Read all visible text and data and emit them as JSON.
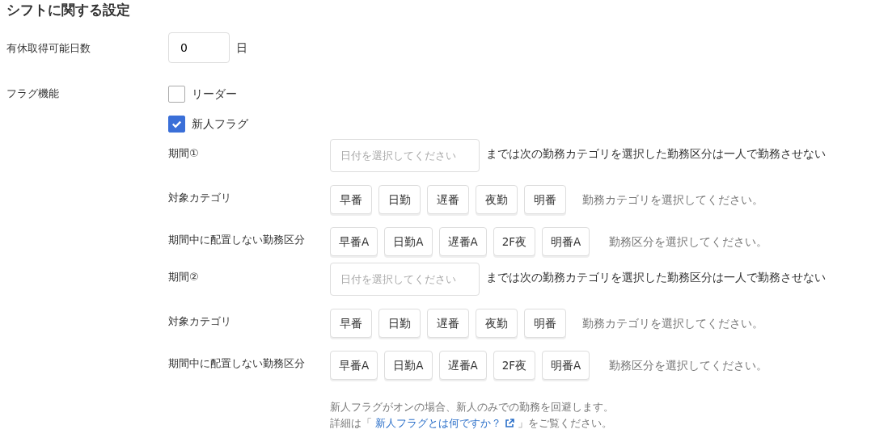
{
  "title": "シフトに関する設定",
  "paid_leave": {
    "label": "有休取得可能日数",
    "value": "0",
    "unit": "日"
  },
  "flags": {
    "label": "フラグ機能",
    "items": [
      {
        "label": "リーダー",
        "checked": false
      },
      {
        "label": "新人フラグ",
        "checked": true
      }
    ]
  },
  "periods": [
    {
      "label": "期間①",
      "placeholder": "日付を選択してください",
      "suffix": "までは次の勤務カテゴリを選択した勤務区分は一人で勤務させない",
      "category_label": "対象カテゴリ",
      "categories": [
        "早番",
        "日勤",
        "遅番",
        "夜勤",
        "明番"
      ],
      "category_hint": "勤務カテゴリを選択してください。",
      "exclusion_label": "期間中に配置しない勤務区分",
      "shifts": [
        "早番A",
        "日勤A",
        "遅番A",
        "2F夜",
        "明番A"
      ],
      "shift_hint": "勤務区分を選択してください。"
    },
    {
      "label": "期間②",
      "placeholder": "日付を選択してください",
      "suffix": "までは次の勤務カテゴリを選択した勤務区分は一人で勤務させない",
      "category_label": "対象カテゴリ",
      "categories": [
        "早番",
        "日勤",
        "遅番",
        "夜勤",
        "明番"
      ],
      "category_hint": "勤務カテゴリを選択してください。",
      "exclusion_label": "期間中に配置しない勤務区分",
      "shifts": [
        "早番A",
        "日勤A",
        "遅番A",
        "2F夜",
        "明番A"
      ],
      "shift_hint": "勤務区分を選択してください。"
    }
  ],
  "help": {
    "line1": "新人フラグがオンの場合、新人のみでの勤務を回避します。",
    "before": "詳細は「",
    "link": "新人フラグとは何ですか？",
    "after": "」をご覧ください。"
  }
}
